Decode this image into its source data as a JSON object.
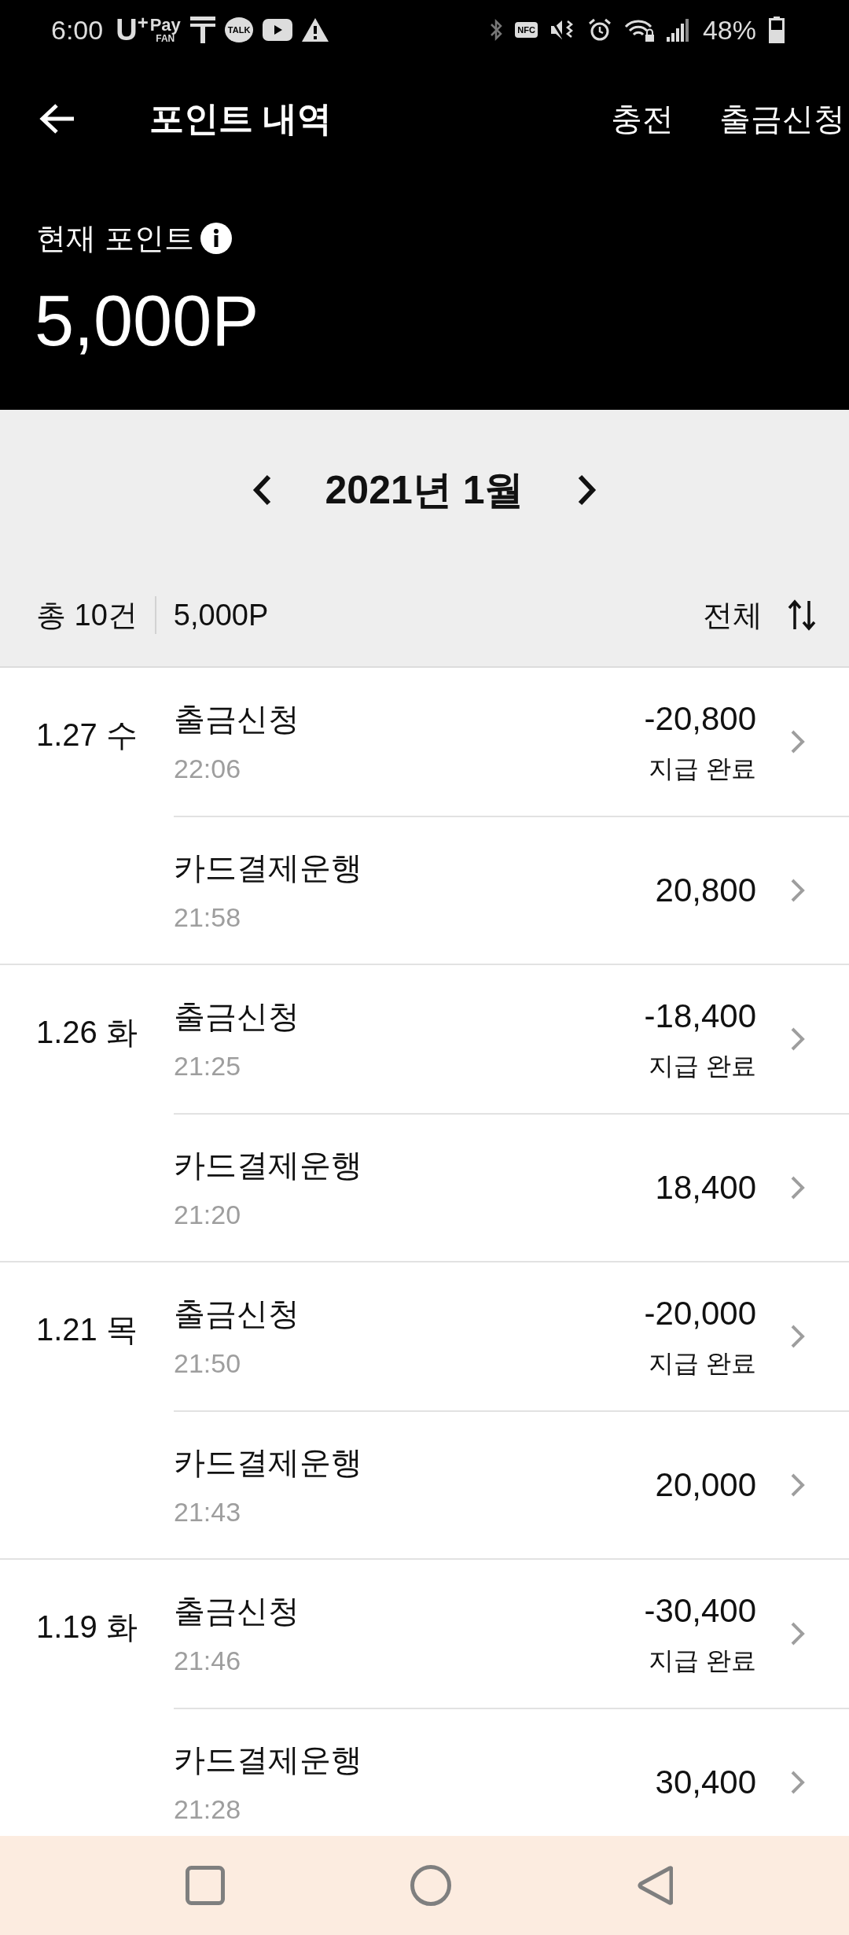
{
  "status_bar": {
    "time": "6:00",
    "notifications": [
      {
        "kind": "pay",
        "mark": "U$^{+}$",
        "top": "Pay",
        "bottom": "FAN"
      },
      {
        "kind": "t"
      },
      {
        "kind": "talk",
        "label": "TALK"
      },
      {
        "kind": "youtube"
      },
      {
        "kind": "warning"
      }
    ],
    "system": [
      {
        "kind": "bluetooth"
      },
      {
        "kind": "nfc",
        "label": "NFC"
      },
      {
        "kind": "mute"
      },
      {
        "kind": "alarm"
      },
      {
        "kind": "wifi"
      },
      {
        "kind": "signal"
      }
    ],
    "battery": "48%"
  },
  "header": {
    "title": "포인트 내역",
    "actions": [
      "충전",
      "출금신청"
    ]
  },
  "balance": {
    "label": "현재 포인트",
    "value": "5,000P"
  },
  "month_nav": {
    "label": "2021년 1월"
  },
  "summary": {
    "count": "총 10건",
    "total": "5,000P",
    "filter": "전체"
  },
  "groups": [
    {
      "date": "1.27 수",
      "items": [
        {
          "title": "출금신청",
          "time": "22:06",
          "amount": "-20,800",
          "status": "지급 완료"
        },
        {
          "title": "카드결제운행",
          "time": "21:58",
          "amount": "20,800"
        }
      ]
    },
    {
      "date": "1.26 화",
      "items": [
        {
          "title": "출금신청",
          "time": "21:25",
          "amount": "-18,400",
          "status": "지급 완료"
        },
        {
          "title": "카드결제운행",
          "time": "21:20",
          "amount": "18,400"
        }
      ]
    },
    {
      "date": "1.21 목",
      "items": [
        {
          "title": "출금신청",
          "time": "21:50",
          "amount": "-20,000",
          "status": "지급 완료"
        },
        {
          "title": "카드결제운행",
          "time": "21:43",
          "amount": "20,000"
        }
      ]
    },
    {
      "date": "1.19 화",
      "items": [
        {
          "title": "출금신청",
          "time": "21:46",
          "amount": "-30,400",
          "status": "지급 완료"
        },
        {
          "title": "카드결제운행",
          "time": "21:28",
          "amount": "30,400"
        }
      ]
    }
  ]
}
